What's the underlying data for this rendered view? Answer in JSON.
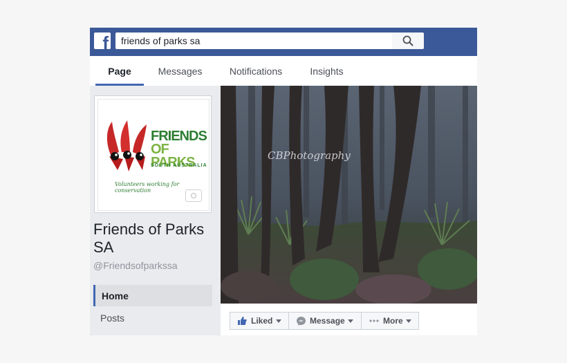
{
  "search": {
    "value": "friends of parks sa"
  },
  "logo": {
    "letter": "f"
  },
  "tabs": [
    {
      "label": "Page"
    },
    {
      "label": "Messages"
    },
    {
      "label": "Notifications"
    },
    {
      "label": "Insights"
    }
  ],
  "profile": {
    "logo_line1": "FRIENDS",
    "logo_line2": "OF PARKS",
    "logo_sub": "SOUTH AUSTRALIA",
    "logo_tagline": "Volunteers working for conservation"
  },
  "page": {
    "name": "Friends of Parks SA",
    "handle": "@Friendsofparkssa"
  },
  "nav": [
    {
      "label": "Home"
    },
    {
      "label": "Posts"
    }
  ],
  "cover": {
    "watermark": "CBPhotography"
  },
  "actions": {
    "liked": "Liked",
    "message": "Message",
    "more": "More"
  },
  "colors": {
    "brand_blue": "#3b5998",
    "accent": "#4267b2",
    "background": "#e9ebee"
  },
  "icons": [
    "facebook-logo-icon",
    "search-icon",
    "camera-icon",
    "thumbs-up-icon",
    "messenger-icon",
    "more-dots-icon",
    "chevron-down-icon"
  ]
}
